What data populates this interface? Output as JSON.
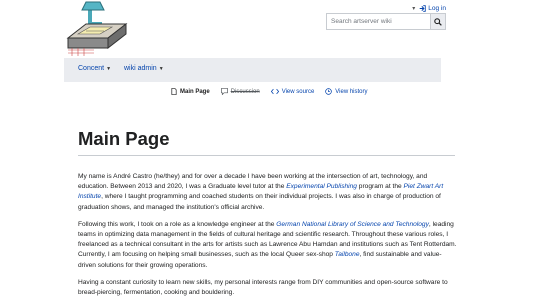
{
  "user": {
    "login_label": "Log in"
  },
  "search": {
    "placeholder": "Search artserver wiki"
  },
  "nav": {
    "items": [
      {
        "label": "Concent"
      },
      {
        "label": "wiki admin"
      }
    ]
  },
  "tabs": [
    {
      "label": "Main Page",
      "icon": "page-icon"
    },
    {
      "label": "Discussion",
      "icon": "chat-icon"
    },
    {
      "label": "View source",
      "icon": "code-icon"
    },
    {
      "label": "View history",
      "icon": "history-icon"
    }
  ],
  "page": {
    "title": "Main Page",
    "p1": {
      "t1": "My name is André Castro (he/they) and for over a decade I have been working at the intersection of art, technology, and education. Between 2013 and 2020, I was a Graduate level tutor at the ",
      "link1": "Experimental Publishing",
      "t2": " program at the ",
      "link2": "Piet Zwart Art Institute",
      "t3": ", where I taught programming and coached students on their individual projects. I was also in charge of production of graduation shows, and managed the institution's official archive."
    },
    "p2": {
      "t1": "Following this work, I took on a role as a knowledge engineer at the ",
      "link1": "German National Library of Science and Technology",
      "t2": ", leading teams in optimizing data management in the fields of cultural heritage and scientific research. Throughout these various roles, I freelanced as a technical consultant in the arts for artists such as  Lawrence Abu Hamdan and institutions such as Tent Rotterdam. Currently, I am focusing on helping small businesses, such as the local Queer sex-shop ",
      "link2": "Tailbone",
      "t3": ", find sustainable and value-driven solutions for their growing operations."
    },
    "p3": {
      "t1": "Having a constant curiosity to learn new skills, my personal interests range from DIY communities and open-source software to bread-piercing, fermentation, cooking and bouldering."
    }
  }
}
